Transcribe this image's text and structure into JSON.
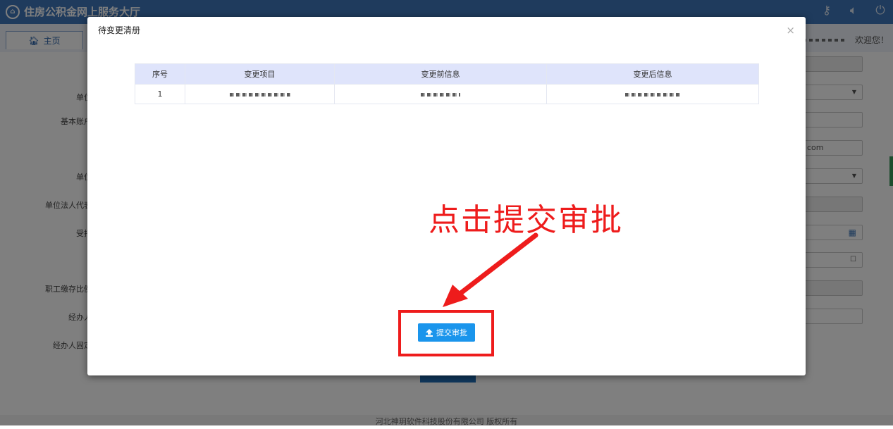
{
  "app": {
    "title": "住房公积金网上服务大厅",
    "home_tab": "主页",
    "welcome": "欢迎您！"
  },
  "form": {
    "labels": [
      "单位",
      "基本账户",
      "单位",
      "单位法人代表",
      "受托",
      "职工缴存比例",
      "经办人",
      "经办人固定"
    ],
    "email_partial": "com"
  },
  "footer": {
    "copyright": "河北神玥软件科技股份有限公司 版权所有"
  },
  "modal": {
    "title": "待变更清册",
    "close_label": "×",
    "columns": [
      "序号",
      "变更项目",
      "变更前信息",
      "变更后信息"
    ],
    "rows": [
      {
        "index": "1"
      }
    ],
    "submit_label": "提交审批"
  },
  "annotation": {
    "text": "点击提交审批",
    "color": "#ee1c1c"
  },
  "colors": {
    "header_blue": "#3f77ba",
    "button_blue": "#1a95ec",
    "table_header": "#dfe4fb"
  }
}
